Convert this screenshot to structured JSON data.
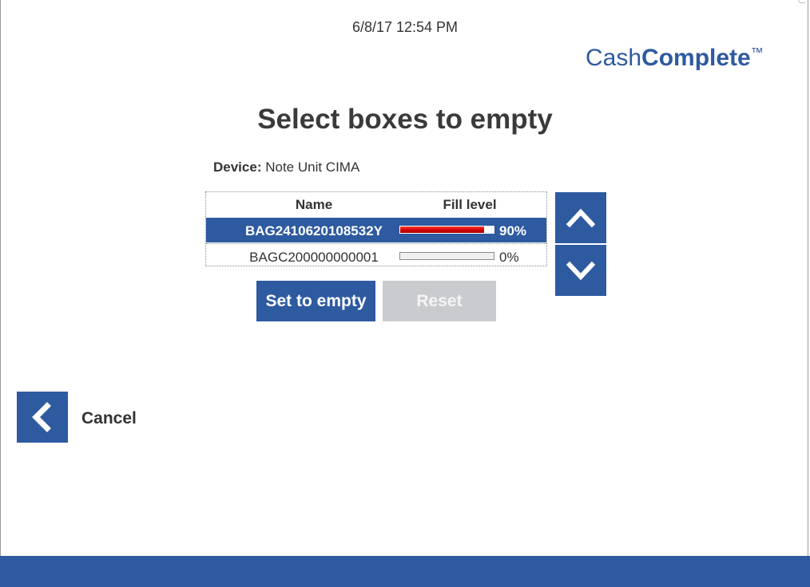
{
  "header": {
    "datetime": "6/8/17 12:54 PM",
    "logo": {
      "light": "Cash",
      "bold": "Complete",
      "tm": "™"
    }
  },
  "main": {
    "title": "Select boxes to empty",
    "device_label": "Device:",
    "device_value": "Note Unit CIMA",
    "table": {
      "columns": [
        "Name",
        "Fill level"
      ],
      "rows": [
        {
          "name": "BAG2410620108532Y",
          "fill_percent": 90,
          "fill_label": "90%",
          "selected": true
        },
        {
          "name": "BAGC200000000001",
          "fill_percent": 0,
          "fill_label": "0%",
          "selected": false
        }
      ]
    },
    "scroll": {
      "up_icon": "chevron-up-icon",
      "down_icon": "chevron-down-icon"
    },
    "buttons": {
      "set_empty": "Set to empty",
      "reset": "Reset"
    }
  },
  "footer": {
    "back_icon": "chevron-left-icon",
    "cancel_label": "Cancel"
  },
  "colors": {
    "primary": "#2e5aa0",
    "fill_bar": "#d40000",
    "disabled": "#c9cbce"
  }
}
